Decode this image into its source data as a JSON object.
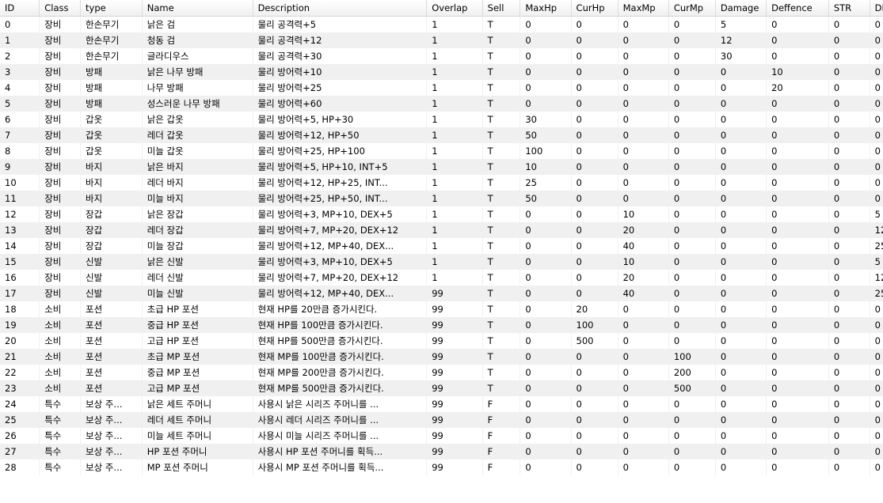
{
  "columns": [
    "ID",
    "Class",
    "type",
    "Name",
    "Description",
    "Overlap",
    "Sell",
    "MaxHp",
    "CurHp",
    "MaxMp",
    "CurMp",
    "Damage",
    "Deffence",
    "STR",
    "DEX"
  ],
  "rows": [
    [
      "0",
      "장비",
      "한손무기",
      "낡은 검",
      "물리 공격력+5",
      "1",
      "T",
      "0",
      "0",
      "0",
      "0",
      "5",
      "0",
      "0",
      "0"
    ],
    [
      "1",
      "장비",
      "한손무기",
      "청동 검",
      "물리 공격력+12",
      "1",
      "T",
      "0",
      "0",
      "0",
      "0",
      "12",
      "0",
      "0",
      "0"
    ],
    [
      "2",
      "장비",
      "한손무기",
      "글라디우스",
      "물리 공격력+30",
      "1",
      "T",
      "0",
      "0",
      "0",
      "0",
      "30",
      "0",
      "0",
      "0"
    ],
    [
      "3",
      "장비",
      "방패",
      "낡은 나무 방패",
      "물리 방어력+10",
      "1",
      "T",
      "0",
      "0",
      "0",
      "0",
      "0",
      "10",
      "0",
      "0"
    ],
    [
      "4",
      "장비",
      "방패",
      "나무 방패",
      "물리 방어력+25",
      "1",
      "T",
      "0",
      "0",
      "0",
      "0",
      "0",
      "20",
      "0",
      "0"
    ],
    [
      "5",
      "장비",
      "방패",
      "성스러운 나무 방패",
      "물리 방어력+60",
      "1",
      "T",
      "0",
      "0",
      "0",
      "0",
      "0",
      "0",
      "0",
      "0"
    ],
    [
      "6",
      "장비",
      "갑옷",
      "낡은 갑옷",
      "물리 방어력+5, HP+30",
      "1",
      "T",
      "30",
      "0",
      "0",
      "0",
      "0",
      "0",
      "0",
      "0"
    ],
    [
      "7",
      "장비",
      "갑옷",
      "레더 갑옷",
      "물리 방어력+12, HP+50",
      "1",
      "T",
      "50",
      "0",
      "0",
      "0",
      "0",
      "0",
      "0",
      "0"
    ],
    [
      "8",
      "장비",
      "갑옷",
      "미늘 갑옷",
      "물리 방어력+25, HP+100",
      "1",
      "T",
      "100",
      "0",
      "0",
      "0",
      "0",
      "0",
      "0",
      "0"
    ],
    [
      "9",
      "장비",
      "바지",
      "낡은 바지",
      "물리 방어력+5, HP+10, INT+5",
      "1",
      "T",
      "10",
      "0",
      "0",
      "0",
      "0",
      "0",
      "0",
      "0"
    ],
    [
      "10",
      "장비",
      "바지",
      "레더 바지",
      "물리 방어력+12, HP+25, INT...",
      "1",
      "T",
      "25",
      "0",
      "0",
      "0",
      "0",
      "0",
      "0",
      "0"
    ],
    [
      "11",
      "장비",
      "바지",
      "미늘 바지",
      "물리 방어력+25, HP+50, INT...",
      "1",
      "T",
      "50",
      "0",
      "0",
      "0",
      "0",
      "0",
      "0",
      "0"
    ],
    [
      "12",
      "장비",
      "장갑",
      "낡은 장갑",
      "물리 방어력+3, MP+10, DEX+5",
      "1",
      "T",
      "0",
      "0",
      "10",
      "0",
      "0",
      "0",
      "0",
      "5"
    ],
    [
      "13",
      "장비",
      "장갑",
      "레더 장갑",
      "물리 방어력+7, MP+20, DEX+12",
      "1",
      "T",
      "0",
      "0",
      "20",
      "0",
      "0",
      "0",
      "0",
      "12"
    ],
    [
      "14",
      "장비",
      "장갑",
      "미늘 장갑",
      "물리 방어력+12, MP+40, DEX...",
      "1",
      "T",
      "0",
      "0",
      "40",
      "0",
      "0",
      "0",
      "0",
      "25"
    ],
    [
      "15",
      "장비",
      "신발",
      "낡은 신발",
      "물리 방어력+3, MP+10, DEX+5",
      "1",
      "T",
      "0",
      "0",
      "10",
      "0",
      "0",
      "0",
      "0",
      "5"
    ],
    [
      "16",
      "장비",
      "신발",
      "레더 신발",
      "물리 방어력+7, MP+20, DEX+12",
      "1",
      "T",
      "0",
      "0",
      "20",
      "0",
      "0",
      "0",
      "0",
      "12"
    ],
    [
      "17",
      "장비",
      "신발",
      "미늘 신발",
      "물리 방어력+12, MP+40, DEX...",
      "99",
      "T",
      "0",
      "0",
      "40",
      "0",
      "0",
      "0",
      "0",
      "25"
    ],
    [
      "18",
      "소비",
      "포션",
      "초급 HP 포션",
      "현재 HP를 20만큼 증가시킨다.",
      "99",
      "T",
      "0",
      "20",
      "0",
      "0",
      "0",
      "0",
      "0",
      "0"
    ],
    [
      "19",
      "소비",
      "포션",
      "중급 HP 포션",
      "현재 HP를 100만큼 증가시킨다.",
      "99",
      "T",
      "0",
      "100",
      "0",
      "0",
      "0",
      "0",
      "0",
      "0"
    ],
    [
      "20",
      "소비",
      "포션",
      "고급 HP 포션",
      "현재 HP를 500만큼 증가시킨다.",
      "99",
      "T",
      "0",
      "500",
      "0",
      "0",
      "0",
      "0",
      "0",
      "0"
    ],
    [
      "21",
      "소비",
      "포션",
      "초급 MP 포션",
      "현재 MP를 100만큼 증가시킨다.",
      "99",
      "T",
      "0",
      "0",
      "0",
      "100",
      "0",
      "0",
      "0",
      "0"
    ],
    [
      "22",
      "소비",
      "포션",
      "중급 MP 포션",
      "현재 MP를 200만큼 증가시킨다.",
      "99",
      "T",
      "0",
      "0",
      "0",
      "200",
      "0",
      "0",
      "0",
      "0"
    ],
    [
      "23",
      "소비",
      "포션",
      "고급 MP 포션",
      "현재 MP를 500만큼 증가시킨다.",
      "99",
      "T",
      "0",
      "0",
      "0",
      "500",
      "0",
      "0",
      "0",
      "0"
    ],
    [
      "24",
      "특수",
      "보상 주...",
      "낡은 세트 주머니",
      "사용시 낡은 시리즈 주머니를 ...",
      "99",
      "F",
      "0",
      "0",
      "0",
      "0",
      "0",
      "0",
      "0",
      "0"
    ],
    [
      "25",
      "특수",
      "보상 주...",
      "레더 세트 주머니",
      "사용시 레더 시리즈 주머니를 ...",
      "99",
      "F",
      "0",
      "0",
      "0",
      "0",
      "0",
      "0",
      "0",
      "0"
    ],
    [
      "26",
      "특수",
      "보상 주...",
      "미늘 세트 주머니",
      "사용시 미늘 시리즈 주머니를 ...",
      "99",
      "F",
      "0",
      "0",
      "0",
      "0",
      "0",
      "0",
      "0",
      "0"
    ],
    [
      "27",
      "특수",
      "보상 주...",
      "HP 포션 주머니",
      "사용시 HP 포션 주머니를 획득...",
      "99",
      "F",
      "0",
      "0",
      "0",
      "0",
      "0",
      "0",
      "0",
      "0"
    ],
    [
      "28",
      "특수",
      "보상 주...",
      "MP 포션 주머니",
      "사용시 MP 포션 주머니를 획득...",
      "99",
      "F",
      "0",
      "0",
      "0",
      "0",
      "0",
      "0",
      "0",
      "0"
    ]
  ]
}
